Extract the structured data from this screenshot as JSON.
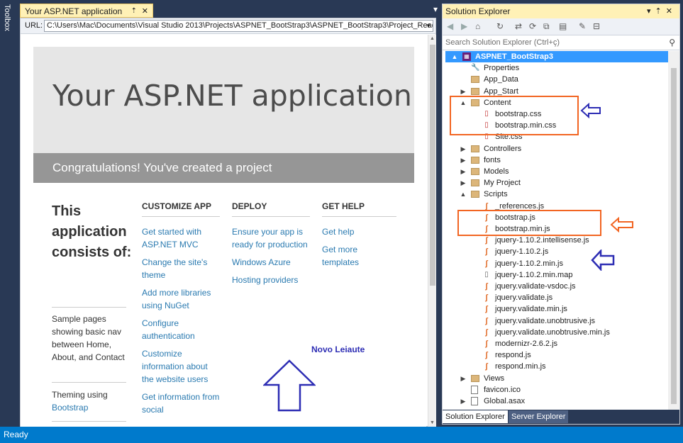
{
  "toolbox": {
    "label": "Toolbox"
  },
  "document": {
    "tab_title": "Your ASP.NET application",
    "pin_glyph": "⇡",
    "close_glyph": "✕",
    "url_label": "URL:",
    "url_value": "C:\\Users\\Mac\\Documents\\Visual Studio 2013\\Projects\\ASPNET_BootStrap3\\ASPNET_BootStrap3\\Project_Readm"
  },
  "page": {
    "hero_title": "Your ASP.NET application",
    "hero_subtitle": "Congratulations! You've created a project",
    "consists_heading": "This application consists of:",
    "sample_pages": "Sample pages showing basic nav between Home, About, and Contact",
    "theming": "Theming using",
    "bootstrap_link": "Bootstrap",
    "columns": [
      {
        "heading": "CUSTOMIZE APP",
        "links": [
          "Get started with ASP.NET MVC",
          "Change the site's theme",
          "Add more libraries using NuGet",
          "Configure authentication",
          "Customize information about the website users",
          "Get information from social"
        ]
      },
      {
        "heading": "DEPLOY",
        "links": [
          "Ensure your app is ready for production",
          "Windows Azure",
          "Hosting providers"
        ]
      },
      {
        "heading": "GET HELP",
        "links": [
          "Get help",
          "Get more templates"
        ]
      }
    ],
    "annotation": "Novo Leiaute"
  },
  "solution_explorer": {
    "title": "Solution Explorer",
    "search_placeholder": "Search Solution Explorer (Ctrl+ç)",
    "tabs": [
      "Solution Explorer",
      "Server Explorer"
    ],
    "nodes": [
      {
        "label": "ASPNET_BootStrap3",
        "icon": "project-icon",
        "expander": "▲",
        "level": 0
      },
      {
        "label": "Properties",
        "icon": "wrench-icon",
        "expander": "",
        "level": 1
      },
      {
        "label": "App_Data",
        "icon": "folder-icon",
        "expander": "",
        "level": 1
      },
      {
        "label": "App_Start",
        "icon": "folder-icon",
        "expander": "▶",
        "level": 1
      },
      {
        "label": "Content",
        "icon": "folder-icon",
        "expander": "▲",
        "level": 1
      },
      {
        "label": "bootstrap.css",
        "icon": "css-file-icon",
        "expander": "",
        "level": 2
      },
      {
        "label": "bootstrap.min.css",
        "icon": "css-file-icon",
        "expander": "",
        "level": 2
      },
      {
        "label": "Site.css",
        "icon": "css-file-icon",
        "expander": "",
        "level": 2
      },
      {
        "label": "Controllers",
        "icon": "folder-icon",
        "expander": "▶",
        "level": 1
      },
      {
        "label": "fonts",
        "icon": "folder-icon",
        "expander": "▶",
        "level": 1
      },
      {
        "label": "Models",
        "icon": "folder-icon",
        "expander": "▶",
        "level": 1
      },
      {
        "label": "My Project",
        "icon": "folder-icon",
        "expander": "▶",
        "level": 1
      },
      {
        "label": "Scripts",
        "icon": "folder-icon",
        "expander": "▲",
        "level": 1
      },
      {
        "label": "_references.js",
        "icon": "js-file-icon",
        "expander": "",
        "level": 2
      },
      {
        "label": "bootstrap.js",
        "icon": "js-file-icon",
        "expander": "",
        "level": 2
      },
      {
        "label": "bootstrap.min.js",
        "icon": "js-file-icon",
        "expander": "",
        "level": 2
      },
      {
        "label": "jquery-1.10.2.intellisense.js",
        "icon": "js-file-icon",
        "expander": "",
        "level": 2
      },
      {
        "label": "jquery-1.10.2.js",
        "icon": "js-file-icon",
        "expander": "",
        "level": 2
      },
      {
        "label": "jquery-1.10.2.min.js",
        "icon": "js-file-icon",
        "expander": "",
        "level": 2
      },
      {
        "label": "jquery-1.10.2.min.map",
        "icon": "map-file-icon",
        "expander": "",
        "level": 2
      },
      {
        "label": "jquery.validate-vsdoc.js",
        "icon": "js-file-icon",
        "expander": "",
        "level": 2
      },
      {
        "label": "jquery.validate.js",
        "icon": "js-file-icon",
        "expander": "",
        "level": 2
      },
      {
        "label": "jquery.validate.min.js",
        "icon": "js-file-icon",
        "expander": "",
        "level": 2
      },
      {
        "label": "jquery.validate.unobtrusive.js",
        "icon": "js-file-icon",
        "expander": "",
        "level": 2
      },
      {
        "label": "jquery.validate.unobtrusive.min.js",
        "icon": "js-file-icon",
        "expander": "",
        "level": 2
      },
      {
        "label": "modernizr-2.6.2.js",
        "icon": "js-file-icon",
        "expander": "",
        "level": 2
      },
      {
        "label": "respond.js",
        "icon": "js-file-icon",
        "expander": "",
        "level": 2
      },
      {
        "label": "respond.min.js",
        "icon": "js-file-icon",
        "expander": "",
        "level": 2
      },
      {
        "label": "Views",
        "icon": "folder-icon",
        "expander": "▶",
        "level": 1
      },
      {
        "label": "favicon.ico",
        "icon": "file-icon",
        "expander": "",
        "level": 1
      },
      {
        "label": "Global.asax",
        "icon": "file-icon",
        "expander": "▶",
        "level": 1
      }
    ]
  },
  "status": {
    "text": "Ready"
  },
  "colors": {
    "accent": "#007acc",
    "highlight_orange": "#f26522",
    "arrow_blue": "#2d2db4"
  }
}
